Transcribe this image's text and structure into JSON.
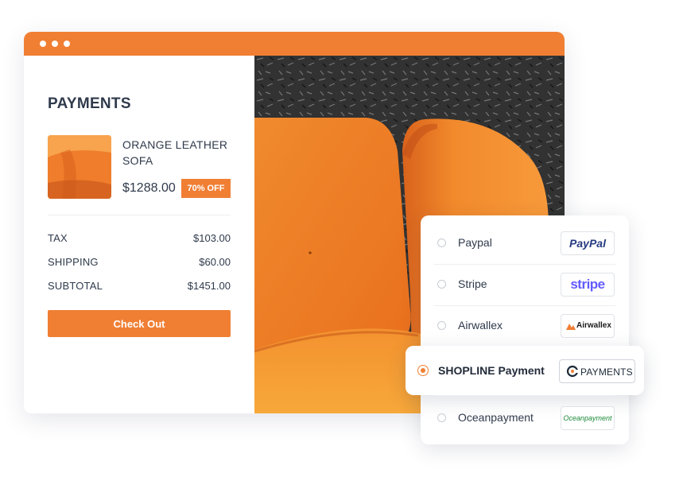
{
  "checkout": {
    "title": "PAYMENTS",
    "product": {
      "name": "ORANGE LEATHER SOFA",
      "price": "$1288.00",
      "discount": "70% OFF"
    },
    "summary": [
      {
        "label": "TAX",
        "value": "$103.00"
      },
      {
        "label": "SHIPPING",
        "value": "$60.00"
      },
      {
        "label": "SUBTOTAL",
        "value": "$1451.00"
      }
    ],
    "checkout_label": "Check Out"
  },
  "payment_methods": [
    {
      "name": "Paypal",
      "logo_text": "PayPal",
      "selected": false
    },
    {
      "name": "Stripe",
      "logo_text": "stripe",
      "selected": false
    },
    {
      "name": "Airwallex",
      "logo_text": "Airwallex",
      "selected": false
    },
    {
      "name": "SHOPLINE Payment",
      "logo_text": "PAYMENTS",
      "selected": true
    },
    {
      "name": "Oceanpayment",
      "logo_text": "Oceanpayment",
      "selected": false
    }
  ],
  "colors": {
    "accent": "#f07f34",
    "text": "#2f3a4c",
    "paypal_dark": "#253b80",
    "paypal_light": "#179bd7",
    "stripe": "#635bff",
    "oceanpayment": "#1a8a3a"
  },
  "icons": {
    "window_controls": "three-dots",
    "selected_radio": "radio-checked",
    "unselected_radio": "radio-empty"
  }
}
